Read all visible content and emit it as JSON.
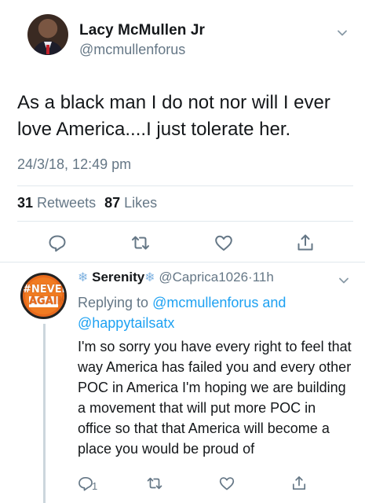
{
  "tweet": {
    "author_name": "Lacy McMullen Jr",
    "author_handle": "@mcmullenforus",
    "text": "As a black man I do not nor will I ever love America....I just tolerate her.",
    "timestamp": "24/3/18, 12:49 pm",
    "retweets_count": "31",
    "retweets_label": "Retweets",
    "likes_count": "87",
    "likes_label": "Likes",
    "actions": [
      "reply-icon",
      "retweet-icon",
      "like-icon",
      "share-icon"
    ]
  },
  "reply": {
    "avatar_text_line1": "#NEVER",
    "avatar_text_line2": "AGAIN",
    "author_name": "Serenity",
    "name_decoration": "❄",
    "author_handle": "@Caprica1026",
    "separator": "·",
    "time": "11h",
    "replying_prefix": "Replying to",
    "replying_user1": "@mcmullenforus",
    "replying_joiner": "and",
    "replying_user2": "@happytailsatx",
    "text": "I'm so sorry you have every right to feel that way America has failed you and every other POC in America I'm hoping we are building a movement that will put more POC in office so that that America will become a place you would be proud of",
    "reply_count": "1",
    "actions": [
      "reply-icon",
      "retweet-icon",
      "like-icon",
      "share-icon"
    ]
  },
  "colors": {
    "text": "#14171a",
    "secondary": "#657786",
    "link": "#1da1f2",
    "divider": "#e1e8ed"
  }
}
